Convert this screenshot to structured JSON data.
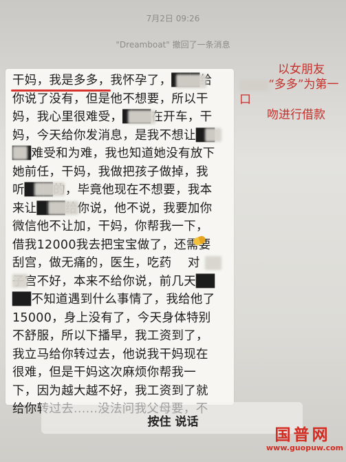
{
  "header": {
    "time": "7月2日 09:26",
    "recall_notice": "\"Dreamboat\" 撤回了一条消息"
  },
  "message": {
    "text": "干妈，我是多多，我怀孕了，███给\n你说了没有，但是他不想要，所以干\n妈，我心里很难受，███在开车，干\n妈，今天给你发消息，是我不想让██\n██难受和为难，我也知道她没有放下\n她前任，干妈，我做把孩子做掉，我\n听███的，毕竟他现在不想要，我本\n来让███给你说，他不说，我要加你\n微信他不让加，干妈，你帮我一下，\n借我12000我去把宝宝做了，还需要\n刮宫，做无痛的，医生，吃药    对\n子宫不好，本来不给你说，前几天██\n██不知道遇到什么事情了，我给他了\n15000，身上没有了，今天身体特别\n不舒服，所以下播早，我工资到了，\n我立马给你转过去，他说我干妈现在\n很难，但是干妈这次麻烦你帮我一\n下，因为越大越不好，我工资到了就\n给你转过去......没法问我父母要，不"
  },
  "annotation": {
    "line1": "以女朋友",
    "line2_a": "“",
    "line2_b": "多多”为第一口",
    "line3": "吻进行借款"
  },
  "input": {
    "talk_label": "按住 说话"
  },
  "watermark": {
    "name": "国普网",
    "url": "www.guopuw.com"
  },
  "colors": {
    "annotation": "#c4302b",
    "watermark": "#d42a20",
    "underline": "#d8322e"
  }
}
